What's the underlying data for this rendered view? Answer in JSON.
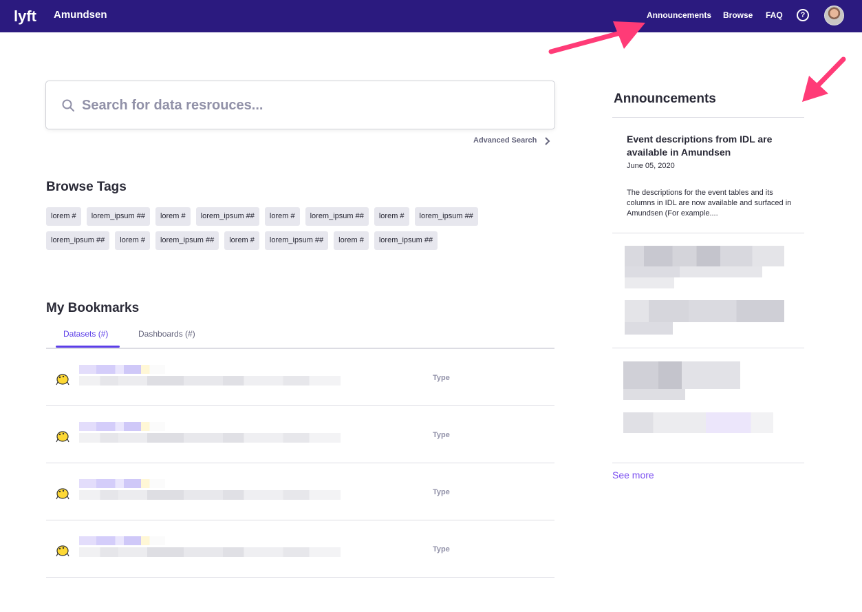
{
  "nav": {
    "app_name": "Amundsen",
    "links": [
      "Announcements",
      "Browse",
      "FAQ"
    ],
    "help_label": "?"
  },
  "search": {
    "placeholder": "Search for data resrouces...",
    "advanced_label": "Advanced Search"
  },
  "browse_tags": {
    "title": "Browse Tags",
    "row1": [
      "lorem #",
      "lorem_ipsum ##",
      "lorem #",
      "lorem_ipsum ##",
      "lorem #",
      "lorem_ipsum ##",
      "lorem #",
      "lorem_ipsum ##"
    ],
    "row2": [
      "lorem_ipsum ##",
      "lorem #",
      "lorem_ipsum ##",
      "lorem #",
      "lorem_ipsum ##",
      "lorem #",
      "lorem_ipsum ##"
    ]
  },
  "bookmarks": {
    "title": "My Bookmarks",
    "tabs": [
      "Datasets (#)",
      "Dashboards (#)"
    ],
    "rows": [
      {
        "type_label": "Type"
      },
      {
        "type_label": "Type"
      },
      {
        "type_label": "Type"
      },
      {
        "type_label": "Type"
      }
    ]
  },
  "announcements": {
    "title": "Announcements",
    "items": [
      {
        "heading": "Event descriptions from IDL are available in Amundsen",
        "date": "June 05, 2020",
        "body": "The descriptions for the event tables and its columns in IDL are now available and surfaced in Amundsen (For example...."
      }
    ],
    "see_more": "See more"
  },
  "colors": {
    "nav_bg": "#2b1a7f",
    "accent": "#5c3ee8",
    "arrow": "#ff3b77",
    "link": "#7b4ff0"
  }
}
